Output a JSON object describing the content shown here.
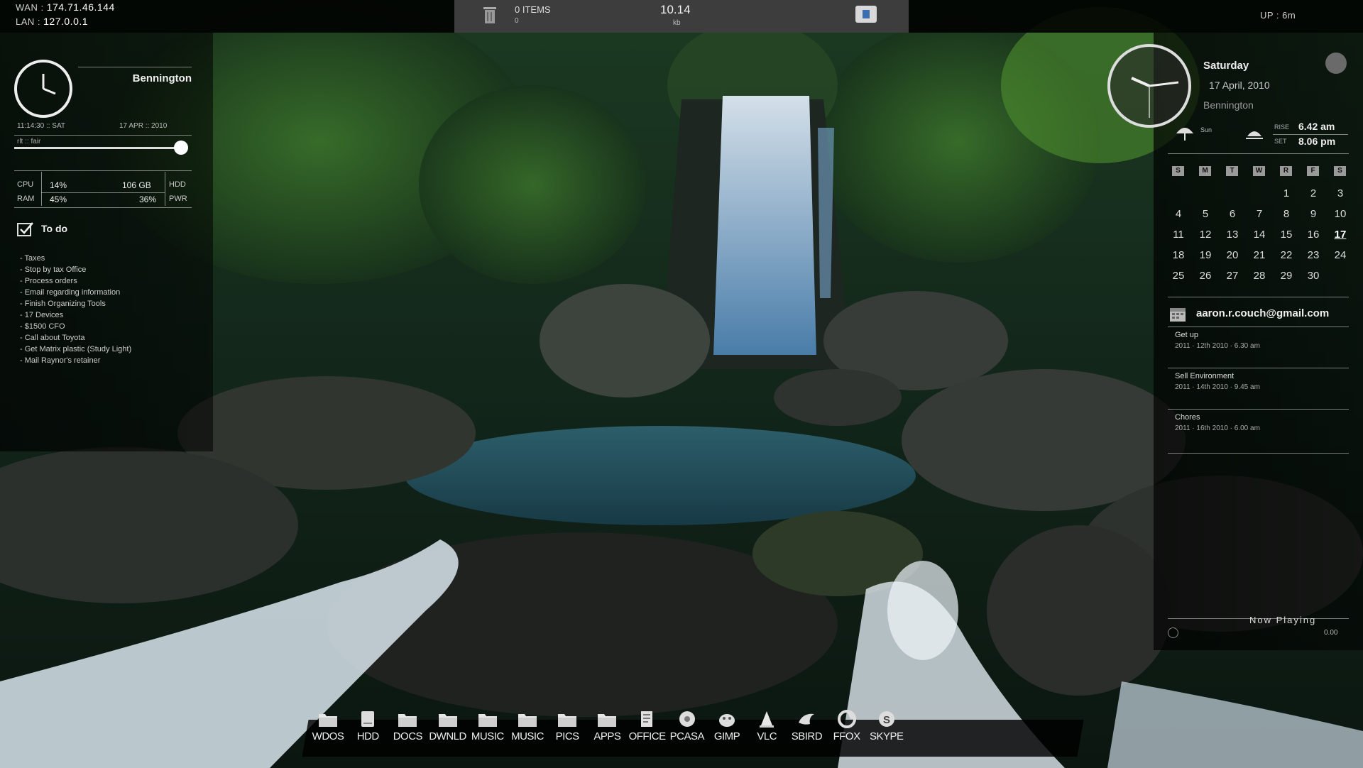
{
  "topbar": {
    "wan_label": "WAN :",
    "wan_ip": "174.71.46.144",
    "lan_label": "LAN :",
    "lan_ip": "127.0.0.1",
    "trash_items": "0 ITEMS",
    "trash_sub": "0",
    "center_value": "10.14",
    "center_sub": "kb",
    "uptime": "UP : 6m"
  },
  "left_panel": {
    "city": "Bennington",
    "time_line": "11:14:30  ::  SAT",
    "date_line": "17 APR  ::  2010",
    "weather_line": "rlt  ::  fair",
    "cpu_label": "CPU",
    "cpu_value": "14%",
    "ram_label": "RAM",
    "ram_value": "45%",
    "hdd_value": "106 GB",
    "pwr_value": "36%",
    "hdd_label": "HDD",
    "pwr_label": "PWR",
    "todo_title": "To do",
    "todo_items": [
      "- Taxes",
      "- Stop by tax Office",
      "- Process orders",
      "- Email regarding information",
      "- Finish Organizing Tools",
      "- 17 Devices",
      "- $1500 CFO",
      "- Call about Toyota",
      "- Get Matrix plastic (Study Light)",
      "- Mail Raynor's retainer"
    ]
  },
  "right_panel": {
    "day": "Saturday",
    "date": "17 April, 2010",
    "city": "Bennington",
    "sun_label": "Sun",
    "rise_label": "RISE",
    "rise_time": "6.42 am",
    "set_label": "SET",
    "set_time": "8.06 pm",
    "cal_headers": [
      "S",
      "M",
      "T",
      "W",
      "R",
      "F",
      "S"
    ],
    "cal_rows": [
      [
        "",
        "",
        "",
        "",
        "1",
        "2",
        "3"
      ],
      [
        "4",
        "5",
        "6",
        "7",
        "8",
        "9",
        "10"
      ],
      [
        "11",
        "12",
        "13",
        "14",
        "15",
        "16",
        "17"
      ],
      [
        "18",
        "19",
        "20",
        "21",
        "22",
        "23",
        "24"
      ],
      [
        "25",
        "26",
        "27",
        "28",
        "29",
        "30",
        ""
      ]
    ],
    "today": "17",
    "email": "aaron.r.couch@gmail.com",
    "events": [
      {
        "title": "Get up",
        "date": "2011 · 12th 2010 · 6.30 am"
      },
      {
        "title": "Sell Environment",
        "date": "2011 · 14th 2010 · 9.45 am"
      },
      {
        "title": "Chores",
        "date": "2011 · 16th 2010 · 6.00 am"
      }
    ],
    "now_playing_label": "Now Playing",
    "now_playing_time": "0.00"
  },
  "dock": {
    "items": [
      {
        "label": "WDOS",
        "icon": "folder-icon"
      },
      {
        "label": "HDD",
        "icon": "hard-drive-icon"
      },
      {
        "label": "DOCS",
        "icon": "folder-icon"
      },
      {
        "label": "DWNLD",
        "icon": "folder-icon"
      },
      {
        "label": "MUSIC",
        "icon": "folder-icon"
      },
      {
        "label": "MUSIC",
        "icon": "folder-icon"
      },
      {
        "label": "PICS",
        "icon": "folder-icon"
      },
      {
        "label": "APPS",
        "icon": "folder-icon"
      },
      {
        "label": "OFFICE",
        "icon": "office-icon"
      },
      {
        "label": "PCASA",
        "icon": "picasa-icon"
      },
      {
        "label": "GIMP",
        "icon": "gimp-icon"
      },
      {
        "label": "VLC",
        "icon": "vlc-cone-icon"
      },
      {
        "label": "SBIRD",
        "icon": "songbird-icon"
      },
      {
        "label": "FFOX",
        "icon": "firefox-icon"
      },
      {
        "label": "SKYPE",
        "icon": "skype-icon"
      }
    ]
  },
  "colors": {
    "accent": "#ffffff",
    "panel_bg": "#000000",
    "today_highlight": "#ffffff"
  }
}
